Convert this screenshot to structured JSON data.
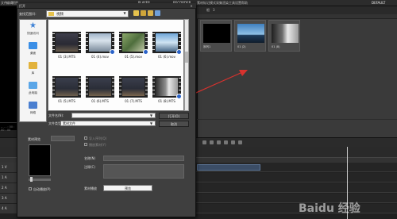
{
  "menubar": {
    "items": [
      "文件",
      "编辑",
      "视图",
      "素材",
      "标记",
      "模式",
      "采集",
      "渲染",
      "工具",
      "设置",
      "帮助"
    ],
    "project": "PLAYER",
    "project2": "RECORDER",
    "status": "DEFAULT"
  },
  "left_panel": {
    "status": "-- - - : 00 : 00 : 00"
  },
  "bin": {
    "tab": "根",
    "tab_count": "3",
    "items": [
      {
        "label": "序列1"
      },
      {
        "label": "01 (2)"
      },
      {
        "label": "01 (8)"
      }
    ]
  },
  "dialog": {
    "title": "打开",
    "close": "✕",
    "look_in_label": "查找范围(I):",
    "look_in_value": "视频",
    "places": [
      {
        "label": "快速访问",
        "icon": "star-icon",
        "color": "#3e82d6"
      },
      {
        "label": "桌面",
        "icon": "desktop-icon",
        "color": "#3a8ee6"
      },
      {
        "label": "库",
        "icon": "library-icon",
        "color": "#e2b23c"
      },
      {
        "label": "此电脑",
        "icon": "computer-icon",
        "color": "#5aa6e8"
      },
      {
        "label": "网络",
        "icon": "network-icon",
        "color": "#4a7fd0"
      }
    ],
    "files": [
      {
        "label": "01 (3).MTS",
        "scene": "dark"
      },
      {
        "label": "01 (4).mov",
        "scene": "sky"
      },
      {
        "label": "01 (5).mov",
        "scene": "green"
      },
      {
        "label": "01 (6).mov",
        "scene": "sky2"
      },
      {
        "label": "01 (5).MTS",
        "scene": "dark"
      },
      {
        "label": "01 (6).MTS",
        "scene": "dark"
      },
      {
        "label": "01 (7).MTS",
        "scene": "dark"
      },
      {
        "label": "01 (8).MTS",
        "scene": "machine"
      }
    ],
    "filename_label": "文件名(N):",
    "filetype_label": "文件类型(T):",
    "filetype_value": "素材文件",
    "open_button": "打开(O)",
    "cancel_button": "取消",
    "preview_label": "素材预览",
    "check_sequence": "导入序列(Q)",
    "check_sequence2": "播放素材(Y)",
    "check_preview": "自动播放(P)",
    "name_label": "名称(N)",
    "comment_label": "注释(C)",
    "duration_label": "素材播放",
    "duration_value": "预览",
    "colors": {
      "accent": "#2b63c9"
    }
  },
  "timeline": {
    "tracks": [
      "1 V",
      "1 A",
      "2 A",
      "3 A",
      "4 A"
    ]
  },
  "watermark": "Baidu 经验"
}
